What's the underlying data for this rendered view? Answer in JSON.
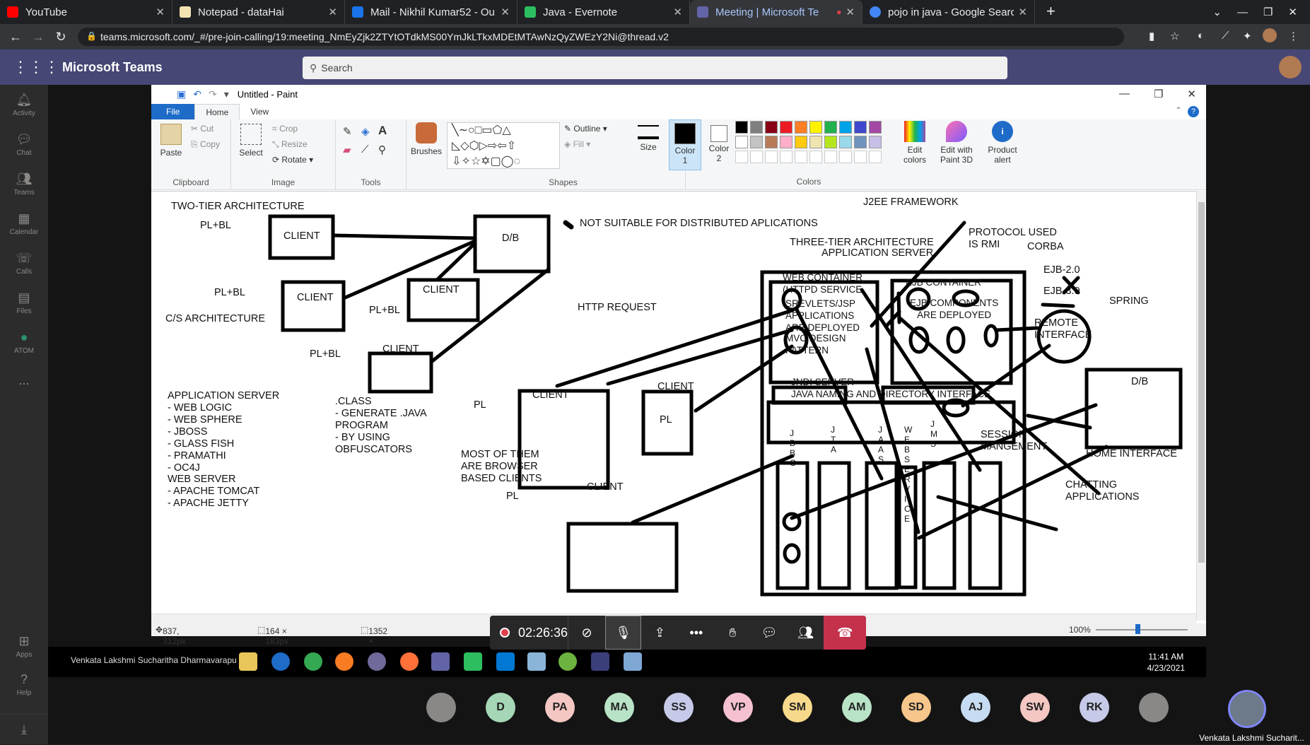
{
  "browser": {
    "tabs": [
      {
        "label": "YouTube",
        "color": "#ff0000"
      },
      {
        "label": "Notepad - dataHai",
        "color": "#f4e3b0"
      },
      {
        "label": "Mail - Nikhil Kumar52 - Ou",
        "color": "#1a73e8"
      },
      {
        "label": "Java - Evernote",
        "color": "#2dbe60"
      },
      {
        "label": "Meeting | Microsoft Te",
        "color": "#6264a7"
      },
      {
        "label": "pojo in java - Google Searc",
        "color": "#4285f4"
      }
    ],
    "url": "teams.microsoft.com/_#/pre-join-calling/19:meeting_NmEyZjk2ZTYtOTdkMS00YmJkLTkxMDEtMTAwNzQyZWEzY2Ni@thread.v2"
  },
  "teams": {
    "app_name": "Microsoft Teams",
    "search_placeholder": "Search",
    "rail": [
      "Activity",
      "Chat",
      "Teams",
      "Calendar",
      "Calls",
      "Files",
      "ATOM",
      "...",
      "Apps",
      "Help"
    ]
  },
  "paint": {
    "title": "Untitled - Paint",
    "tabs": [
      "File",
      "Home",
      "View"
    ],
    "groups": [
      "Clipboard",
      "Image",
      "Tools",
      "Shapes",
      "Colors"
    ],
    "clipboard": {
      "paste": "Paste",
      "cut": "Cut",
      "copy": "Copy"
    },
    "image": {
      "select": "Select",
      "crop": "Crop",
      "resize": "Resize",
      "rotate": "Rotate"
    },
    "brushes": "Brushes",
    "outline": "Outline",
    "fill": "Fill",
    "size": "Size",
    "color1": "Color\n1",
    "color2": "Color\n2",
    "edit_colors": "Edit\ncolors",
    "edit_paint3d": "Edit with\nPaint 3D",
    "product_alert": "Product\nalert",
    "palette": [
      "#000000",
      "#7f7f7f",
      "#880015",
      "#ed1c24",
      "#ff7f27",
      "#fff200",
      "#22b14c",
      "#00a2e8",
      "#3f48cc",
      "#a349a4",
      "#ffffff",
      "#c3c3c3",
      "#b97a57",
      "#ffaec9",
      "#ffc90e",
      "#efe4b0",
      "#b5e61d",
      "#99d9ea",
      "#7092be",
      "#c8bfe7"
    ],
    "status": {
      "cursor": "837, 312px",
      "selection": "164 × 183px",
      "size": "1352 × 611px",
      "zoom": "100%"
    }
  },
  "canvas": {
    "two_tier": "TWO-TIER ARCHITECTURE",
    "plbl1": "PL+BL",
    "plbl2": "PL+BL",
    "plbl3": "PL+BL",
    "plbl4": "PL+BL",
    "client": "CLIENT",
    "db": "D/B",
    "cs_arch": "C/S ARCHITECTURE",
    "not_suitable": "NOT SUITABLE FOR DISTRIBUTED APLICATIONS",
    "http_request": "HTTP REQUEST",
    "j2ee": "J2EE FRAMEWORK",
    "protocol": "PROTOCOL USED\nIS RMI",
    "corba": "CORBA",
    "three_tier": "THREE-TIER ARCHITECTURE",
    "app_server_label": "APPLICATION SERVER",
    "web_container": "WEB CONTAINER\n(HTTPD SERVICE",
    "servlets": "SREVLETS/JSP\nAPPLICATIONS\nARE DEPLOYED",
    "mvc": "MVC DESIGN\nPATTERN",
    "ejb_container": "EJB CONTAINER",
    "ejb_components": "EJB COMPONENTS\nARE DEPLOYED",
    "ejb2": "EJB-2.0",
    "ejb3": "EJB-3.0",
    "spring": "SPRING",
    "remote": "REMOTE\nINTERFACE",
    "jndi": "JNDI SERVER\nJAVA NAMING AND DIRECTORY INTERFACE",
    "jdbc": "J\nD\nB\nC",
    "jta": "J\nT\nA",
    "jaas": "J\nA\nA\nS",
    "webservices": "W\nE\nB\nS\nE\nR\nV\nI\nC\nE",
    "jms": "J\nM\nS",
    "session": "SESSION\nMANGEMENT",
    "home_interface": "HOME INTERFACE",
    "chatting": "CHATTING\nAPPLICATIONS",
    "app_server_list": "APPLICATION SERVER\n- WEB LOGIC\n- WEB SPHERE\n- JBOSS\n- GLASS FISH\n- PRAMATHI\n- OC4J",
    "web_server_list": "WEB SERVER\n- APACHE TOMCAT\n- APACHE JETTY",
    "class_note": ".CLASS\n- GENERATE .JAVA\nPROGRAM\n- BY USING\nOBFUSCATORS",
    "pl": "PL",
    "browser_clients": "MOST OF THEM\nARE BROWSER\nBASED CLIENTS"
  },
  "call": {
    "timer": "02:26:36"
  },
  "taskbar": {
    "user": "Venkata Lakshmi Sucharitha Dharmavarapu",
    "time": "11:41 AM",
    "date": "4/23/2021"
  },
  "participants": [
    {
      "initials": "",
      "color": "#8a8886"
    },
    {
      "initials": "D",
      "color": "#a5d6b5"
    },
    {
      "initials": "PA",
      "color": "#f4c7c3"
    },
    {
      "initials": "MA",
      "color": "#b9e3c6"
    },
    {
      "initials": "SS",
      "color": "#c6c9e8"
    },
    {
      "initials": "VP",
      "color": "#f5c0d0"
    },
    {
      "initials": "SM",
      "color": "#f7d98b"
    },
    {
      "initials": "AM",
      "color": "#b9e3c6"
    },
    {
      "initials": "SD",
      "color": "#f7c68b"
    },
    {
      "initials": "AJ",
      "color": "#c6dcf2"
    },
    {
      "initials": "SW",
      "color": "#f4c7c3"
    },
    {
      "initials": "RK",
      "color": "#c6c9e8"
    },
    {
      "initials": "",
      "color": "#8a8886"
    }
  ],
  "self_name": "Venkata Lakshmi Sucharit..."
}
